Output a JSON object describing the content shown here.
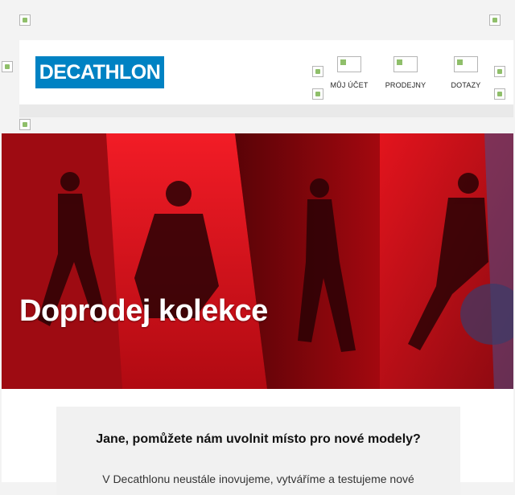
{
  "brand": {
    "logo_text": "DECATHLON",
    "color": "#0082c3"
  },
  "nav": {
    "items": [
      {
        "label": "MŮJ ÚČET",
        "icon": "account-icon"
      },
      {
        "label": "PRODEJNY",
        "icon": "store-icon"
      },
      {
        "label": "DOTAZY",
        "icon": "help-icon"
      }
    ]
  },
  "hero": {
    "title": "Doprodej kolekce",
    "accent_color": "#e30613"
  },
  "message": {
    "heading": "Jane, pomůžete nám uvolnit místo pro nové modely?",
    "body": "V Decathlonu neustále inovujeme, vytváříme a testujeme nové"
  }
}
